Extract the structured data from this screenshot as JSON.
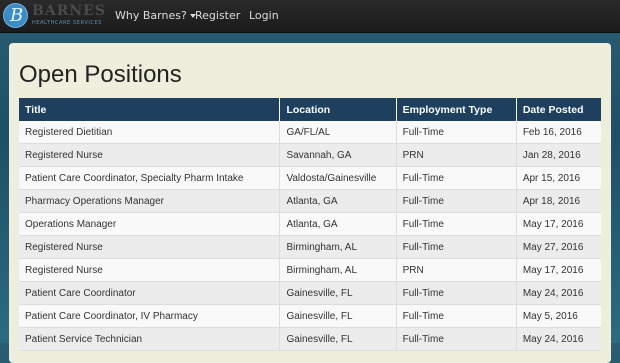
{
  "brand": {
    "name": "BARNES",
    "subtitle": "HEALTHCARE SERVICES"
  },
  "nav": {
    "items": [
      {
        "label": "Why Barnes?",
        "dropdown": true
      },
      {
        "label": "Register"
      },
      {
        "label": "Login"
      }
    ]
  },
  "page": {
    "title": "Open Positions"
  },
  "table": {
    "headers": [
      "Title",
      "Location",
      "Employment Type",
      "Date Posted"
    ],
    "rows": [
      [
        "Registered Dietitian",
        "GA/FL/AL",
        "Full-Time",
        "Feb 16, 2016"
      ],
      [
        "Registered Nurse",
        "Savannah, GA",
        "PRN",
        "Jan 28, 2016"
      ],
      [
        "Patient Care Coordinator, Specialty Pharm Intake",
        "Valdosta/Gainesville",
        "Full-Time",
        "Apr 15, 2016"
      ],
      [
        "Pharmacy Operations Manager",
        "Atlanta, GA",
        "Full-Time",
        "Apr 18, 2016"
      ],
      [
        "Operations Manager",
        "Atlanta, GA",
        "Full-Time",
        "May 17, 2016"
      ],
      [
        "Registered Nurse",
        "Birmingham, AL",
        "Full-Time",
        "May 27, 2016"
      ],
      [
        "Registered Nurse",
        "Birmingham, AL",
        "PRN",
        "May 17, 2016"
      ],
      [
        "Patient Care Coordinator",
        "Gainesville, FL",
        "Full-Time",
        "May 24, 2016"
      ],
      [
        "Patient Care Coordinator, IV Pharmacy",
        "Gainesville, FL",
        "Full-Time",
        "May 5, 2016"
      ],
      [
        "Patient Service Technician",
        "Gainesville, FL",
        "Full-Time",
        "May 24, 2016"
      ]
    ]
  },
  "colors": {
    "header_bg": "#1e3f5e",
    "panel_bg": "#eeeedd",
    "navbar_bg": "#1b1b1b",
    "brand_accent": "#3b8bc4"
  }
}
